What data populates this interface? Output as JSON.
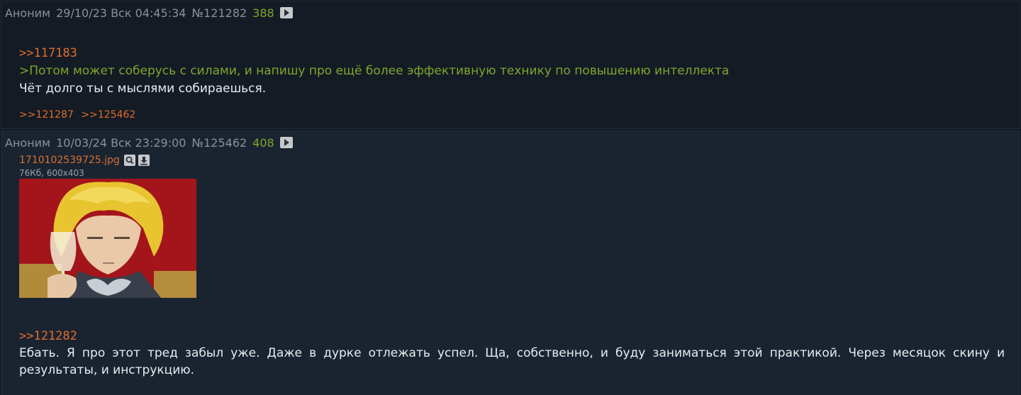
{
  "posts": [
    {
      "author": "Аноним",
      "date": "29/10/23 Вск 04:45:34",
      "number": "№121282",
      "count": "388",
      "reply_to": ">>117183",
      "quote": ">Потом может соберусь с силами, и напишу про ещё более эффективную технику по повышению интеллекта",
      "text": "Чёт долго ты с мыслями собираешься.",
      "backlinks": [
        ">>121287",
        ">>125462"
      ]
    },
    {
      "author": "Аноним",
      "date": "10/03/24 Вск 23:29:00",
      "number": "№125462",
      "count": "408",
      "file": {
        "name": "1710102539725.jpg",
        "meta": "76Кб, 600x403",
        "search_icon": "search-icon",
        "download_icon": "download-icon"
      },
      "reply_to": ">>121282",
      "text": "Ебать. Я про этот тред забыл уже. Даже в дурке отлежать успел. Ща, собственно, и буду заниматься этой практикой. Через месяцок скину и результаты, и инструкцию."
    }
  ],
  "colors": {
    "link": "#e06d2a",
    "greentext": "#7fa62a",
    "text": "#e9ecef",
    "meta": "#8a9099"
  }
}
